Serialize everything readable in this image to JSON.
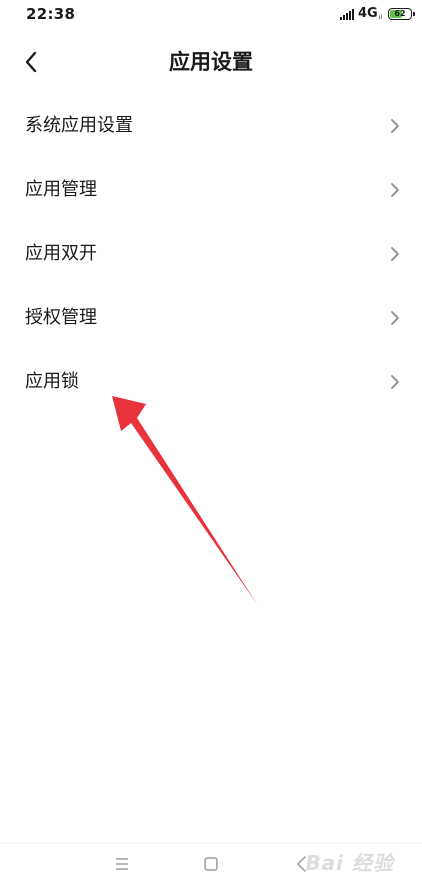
{
  "status_bar": {
    "time": "22:38",
    "network": "4G",
    "network_sub": "ıl",
    "battery_level": "62",
    "battery_fraction": 0.62,
    "battery_color": "#5ec24a"
  },
  "header": {
    "back_icon": "chevron-left-icon",
    "title": "应用设置"
  },
  "settings_list": {
    "items": [
      {
        "label": "系统应用设置"
      },
      {
        "label": "应用管理"
      },
      {
        "label": "应用双开"
      },
      {
        "label": "授权管理"
      },
      {
        "label": "应用锁"
      }
    ]
  },
  "annotation": {
    "arrow_color": "#e8323c"
  },
  "nav_bar": {
    "menu_icon": "menu-icon",
    "home_icon": "home-square-icon",
    "back_icon": "back-triangle-icon"
  },
  "watermark": {
    "text": "Bai 经验"
  }
}
